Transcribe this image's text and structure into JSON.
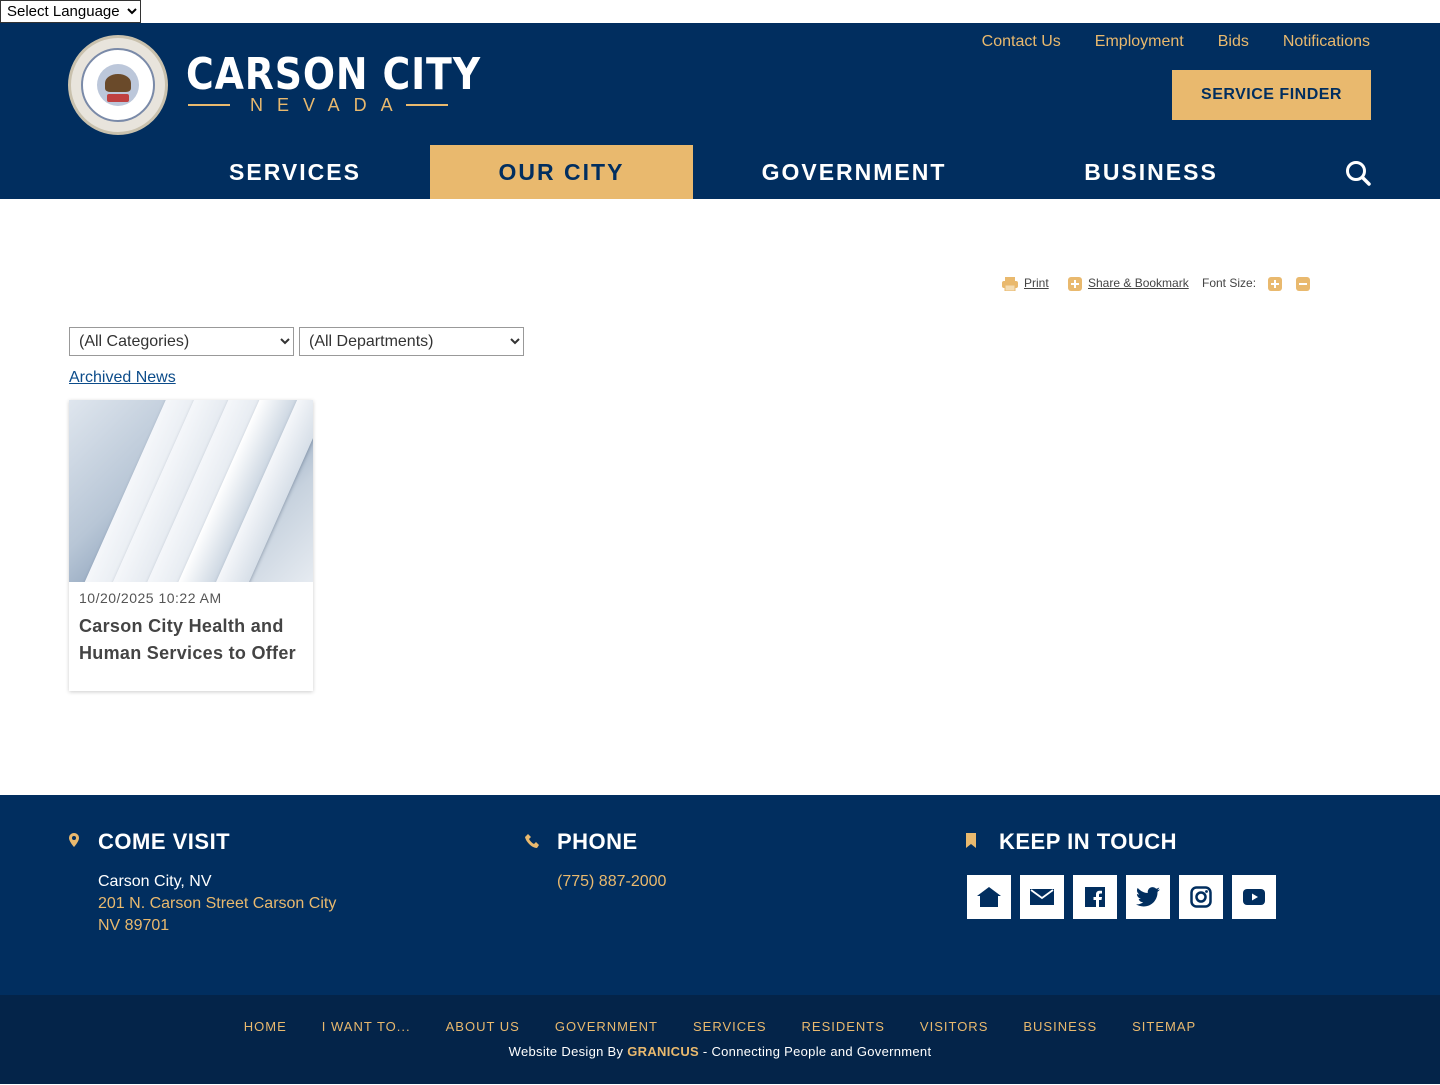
{
  "language": {
    "label": "Select Language"
  },
  "header": {
    "city": "CARSON CITY",
    "state": "NEVADA",
    "utility_links": [
      "Contact Us",
      "Employment",
      "Bids",
      "Notifications"
    ],
    "service_finder": "SERVICE FINDER",
    "nav": [
      {
        "label": "SERVICES",
        "active": false
      },
      {
        "label": "OUR CITY",
        "active": true
      },
      {
        "label": "GOVERNMENT",
        "active": false
      },
      {
        "label": "BUSINESS",
        "active": false
      }
    ]
  },
  "tools": {
    "print": "Print",
    "share": "Share & Bookmark",
    "font_size": "Font Size:"
  },
  "filters": {
    "categories": "(All Categories)",
    "departments": "(All Departments)"
  },
  "archived_link": "Archived News",
  "news": [
    {
      "date": "10/20/2025 10:22 AM",
      "title": "Carson City Health and Human Services to Offer"
    }
  ],
  "footer": {
    "visit": {
      "heading": "COME VISIT",
      "city": "Carson City, NV",
      "street": "201 N. Carson Street Carson City",
      "zip": "NV 89701"
    },
    "phone": {
      "heading": "PHONE",
      "number": "(775) 887-2000"
    },
    "touch": {
      "heading": "KEEP IN TOUCH",
      "social": [
        "home-icon",
        "email-icon",
        "facebook-icon",
        "twitter-icon",
        "instagram-icon",
        "youtube-icon"
      ]
    }
  },
  "bottom": {
    "links": [
      "HOME",
      "I WANT TO...",
      "ABOUT US",
      "GOVERNMENT",
      "SERVICES",
      "RESIDENTS",
      "VISITORS",
      "BUSINESS",
      "SITEMAP"
    ],
    "credit_prefix": "Website Design By ",
    "credit_brand": "GRANICUS",
    "credit_suffix": " - Connecting People and Government"
  },
  "colors": {
    "navy": "#012e5f",
    "gold": "#e9b96e",
    "dark_navy": "#042449"
  }
}
